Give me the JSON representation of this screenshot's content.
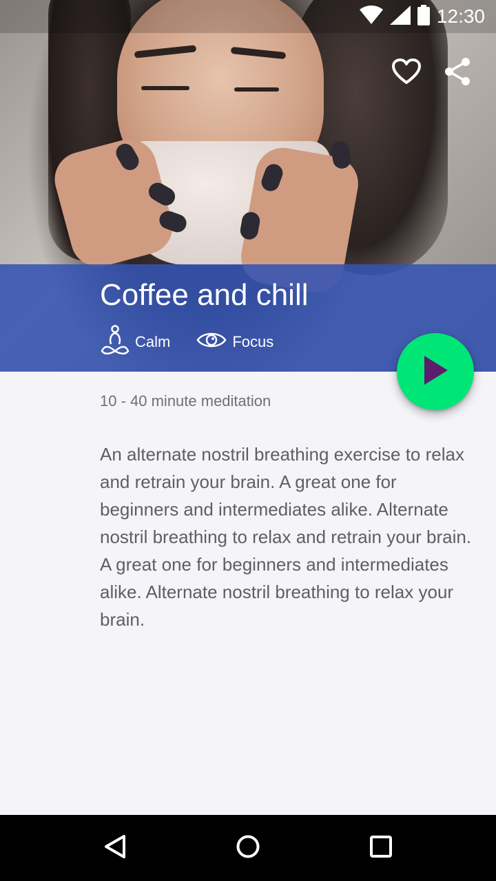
{
  "status_bar": {
    "time": "12:30",
    "icons": [
      "wifi-icon",
      "signal-icon",
      "battery-icon"
    ]
  },
  "actions": {
    "icons": [
      "heart-icon",
      "share-icon"
    ]
  },
  "session": {
    "title": "Coffee and chill",
    "tags": [
      {
        "icon": "meditation-icon",
        "label": "Calm"
      },
      {
        "icon": "eye-icon",
        "label": "Focus"
      }
    ],
    "duration": "10 - 40 minute meditation",
    "description": "An alternate nostril breathing exercise to relax and retrain your brain. A great one for beginners and intermediates alike. Alternate nostril breathing to relax and retrain your brain. A great one for beginners and intermediates alike. Alternate nostril breathing to relax your brain."
  },
  "colors": {
    "band": "#3453b2",
    "fab": "#00e676",
    "play": "#5b1e6f",
    "background": "#f4f4f9"
  },
  "nav": {
    "icons": [
      "back-icon",
      "home-icon",
      "recents-icon"
    ]
  }
}
